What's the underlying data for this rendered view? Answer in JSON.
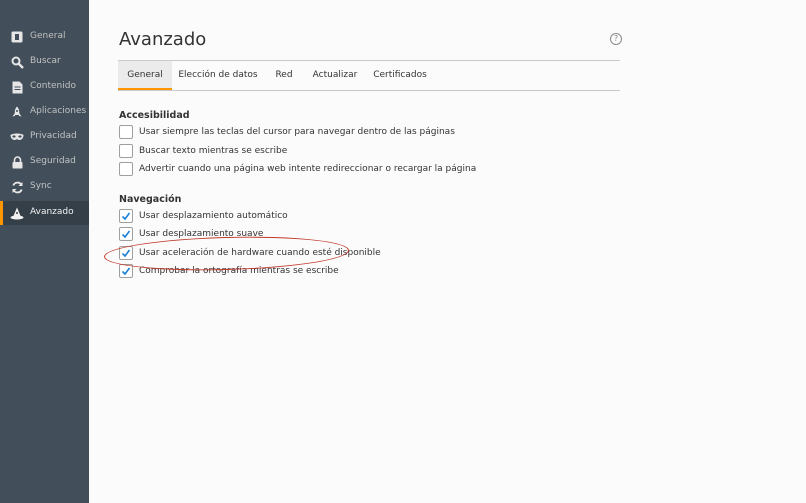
{
  "sidebar": {
    "items": [
      {
        "label": "General",
        "icon": "general-icon"
      },
      {
        "label": "Buscar",
        "icon": "search-icon"
      },
      {
        "label": "Contenido",
        "icon": "document-icon"
      },
      {
        "label": "Aplicaciones",
        "icon": "rocket-icon"
      },
      {
        "label": "Privacidad",
        "icon": "mask-icon"
      },
      {
        "label": "Seguridad",
        "icon": "lock-icon"
      },
      {
        "label": "Sync",
        "icon": "sync-icon"
      },
      {
        "label": "Avanzado",
        "icon": "wizard-hat-icon",
        "selected": true
      }
    ]
  },
  "header": {
    "title": "Avanzado",
    "help_icon": "?"
  },
  "tabs": [
    {
      "label": "General",
      "selected": true
    },
    {
      "label": "Elección de datos"
    },
    {
      "label": "Red"
    },
    {
      "label": "Actualizar"
    },
    {
      "label": "Certificados"
    }
  ],
  "accessibility": {
    "title": "Accesibilidad",
    "options": [
      {
        "label": "Usar siempre las teclas del cursor para navegar dentro de las páginas",
        "checked": false
      },
      {
        "label": "Buscar texto mientras se escribe",
        "checked": false
      },
      {
        "label": "Advertir cuando una página web intente redireccionar o recargar la página",
        "checked": false
      }
    ]
  },
  "navigation": {
    "title": "Navegación",
    "options": [
      {
        "label": "Usar desplazamiento automático",
        "checked": true
      },
      {
        "label": "Usar desplazamiento suave",
        "checked": true
      },
      {
        "label": "Usar aceleración de hardware cuando esté disponible",
        "checked": true
      },
      {
        "label": "Comprobar la ortografía mientras se escribe",
        "checked": true
      }
    ]
  },
  "colors": {
    "sidebar_bg": "#424f5a",
    "accent": "#ff9500",
    "annotation": "#c0392b",
    "check": "#1c7fd6"
  }
}
